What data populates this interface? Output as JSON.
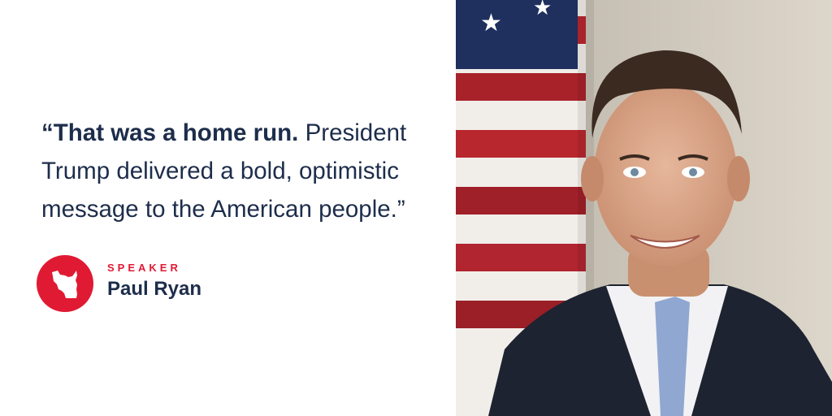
{
  "quote": {
    "lead": "“That was a home run.",
    "rest": "President Trump delivered a bold, optimistic message to the American people.”"
  },
  "speaker": {
    "role": "SPEAKER",
    "name": "Paul Ryan",
    "badge_icon": "wisconsin-state-icon"
  },
  "photo": {
    "subject": "portrait-photo"
  },
  "colors": {
    "accent_red": "#e01a33",
    "navy_text": "#1d2d4b",
    "background": "#ffffff"
  }
}
